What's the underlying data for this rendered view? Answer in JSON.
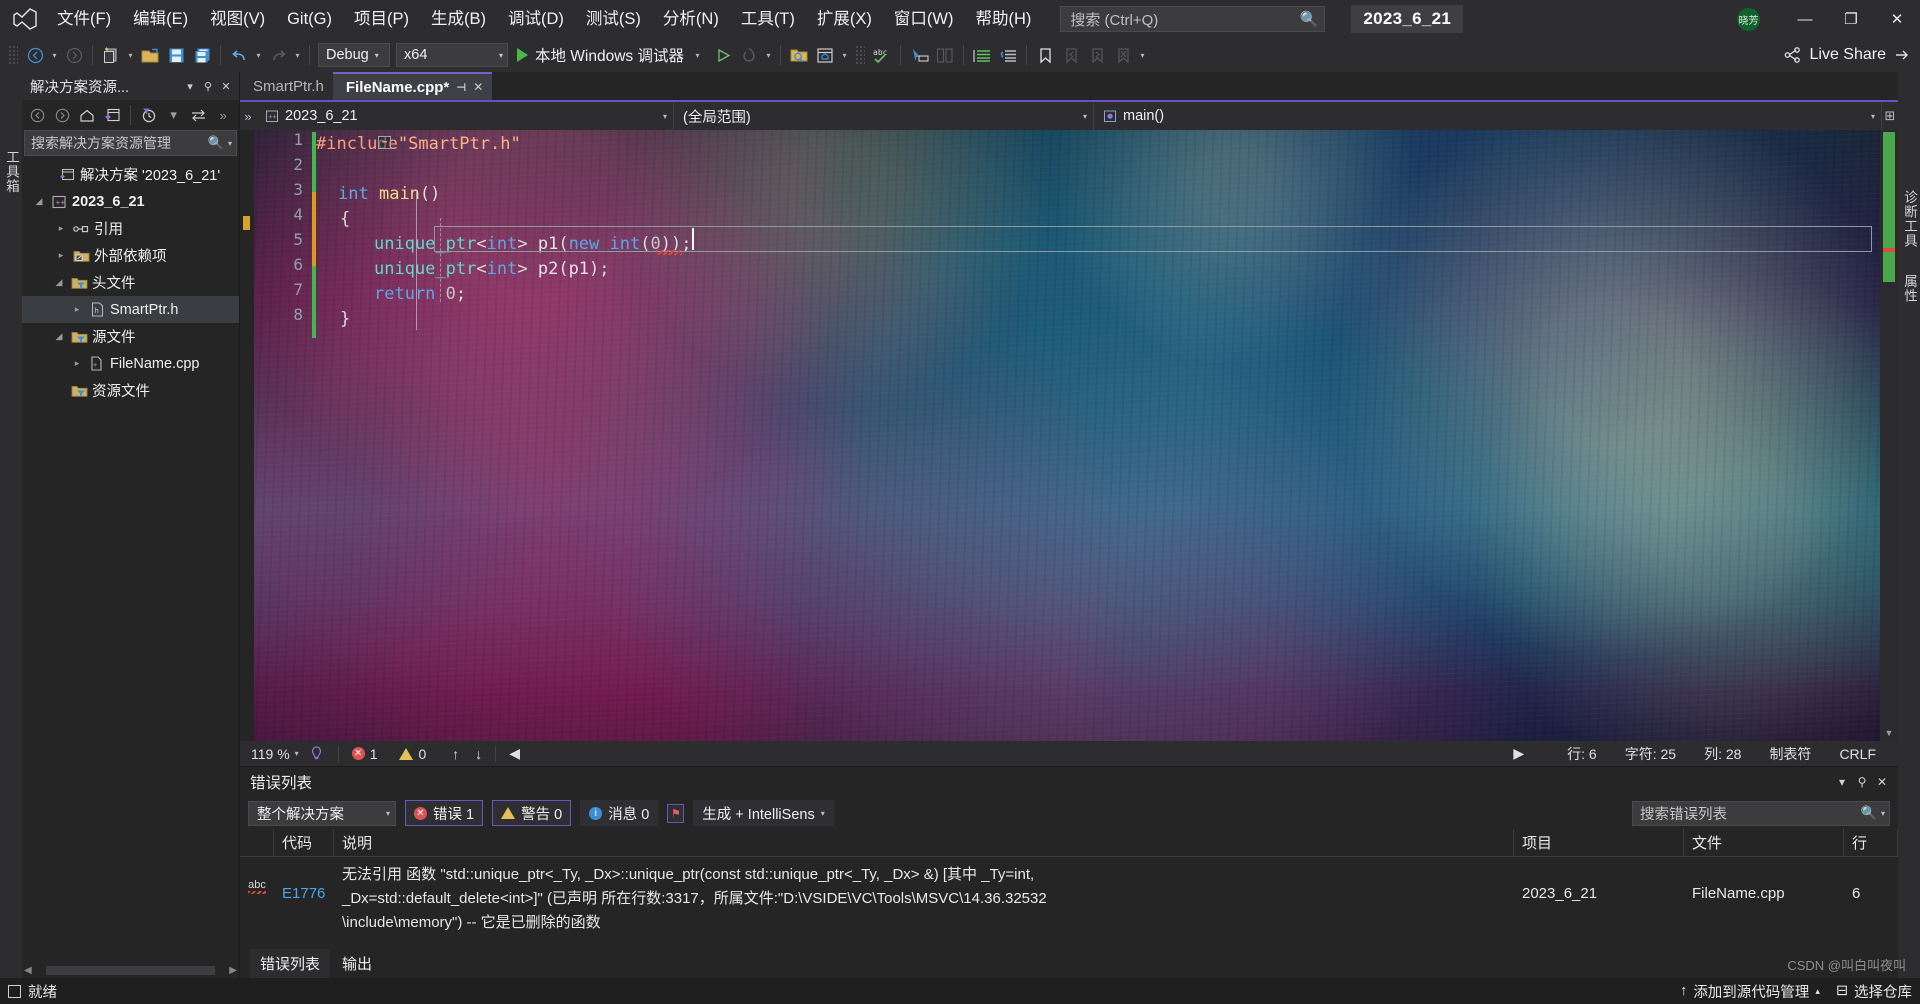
{
  "titlebar": {
    "logo_name": "visual-studio-logo",
    "menus": [
      "文件(F)",
      "编辑(E)",
      "视图(V)",
      "Git(G)",
      "项目(P)",
      "生成(B)",
      "调试(D)",
      "测试(S)",
      "分析(N)",
      "工具(T)",
      "扩展(X)",
      "窗口(W)",
      "帮助(H)"
    ],
    "search_placeholder": "搜索 (Ctrl+Q)",
    "window_title": "2023_6_21",
    "account_initials": "晓芳",
    "minimize": "—",
    "maximize": "❐",
    "close": "✕"
  },
  "toolbar": {
    "back": "←",
    "forward": "→",
    "new_item": "新建项",
    "open_file": "打开文件",
    "save": "保存",
    "save_all": "全部保存",
    "undo": "↶",
    "redo": "↷",
    "config_value": "Debug",
    "platform_value": "x64",
    "run_label": "本地 Windows 调试器",
    "live_share": "Live Share"
  },
  "rails": {
    "left_label": "工具箱",
    "right_top": "诊断工具",
    "right_bottom": "属性"
  },
  "solution_explorer": {
    "title": "解决方案资源...",
    "dropdown_icon": "chevron-down-icon",
    "pin_icon": "pin-icon",
    "close_icon": "close-icon",
    "search_placeholder": "搜索解决方案资源管理",
    "tree": [
      {
        "label": "解决方案 '2023_6_21'",
        "indent": 0,
        "twisty": "",
        "icon": "solution-icon",
        "bold": false,
        "selected": false
      },
      {
        "label": "2023_6_21",
        "indent": 1,
        "twisty": "▴",
        "icon": "project-icon",
        "bold": true,
        "selected": false
      },
      {
        "label": "引用",
        "indent": 2,
        "twisty": "▸",
        "icon": "references-icon",
        "bold": false,
        "selected": false
      },
      {
        "label": "外部依赖项",
        "indent": 2,
        "twisty": "▸",
        "icon": "folder-ext-icon",
        "bold": false,
        "selected": false
      },
      {
        "label": "头文件",
        "indent": 2,
        "twisty": "▴",
        "icon": "folder-filter-icon",
        "bold": false,
        "selected": false
      },
      {
        "label": "SmartPtr.h",
        "indent": 3,
        "twisty": "▸",
        "icon": "header-file-icon",
        "bold": false,
        "selected": true
      },
      {
        "label": "源文件",
        "indent": 2,
        "twisty": "▴",
        "icon": "folder-filter-icon",
        "bold": false,
        "selected": false
      },
      {
        "label": "FileName.cpp",
        "indent": 3,
        "twisty": "▸",
        "icon": "cpp-file-icon",
        "bold": false,
        "selected": false
      },
      {
        "label": "资源文件",
        "indent": 2,
        "twisty": "",
        "icon": "folder-filter-icon",
        "bold": false,
        "selected": false
      }
    ]
  },
  "editor": {
    "tabs": [
      {
        "label": "SmartPtr.h",
        "active": false,
        "modified": false
      },
      {
        "label": "FileName.cpp*",
        "active": true,
        "modified": true
      }
    ],
    "tab_pin_icon": "pin-icon",
    "tab_close_icon": "close-icon",
    "nav_project": "2023_6_21",
    "nav_scope": "(全局范围)",
    "nav_member": "main()",
    "lines": [
      {
        "n": "1",
        "text": "#include\"SmartPtr.h\""
      },
      {
        "n": "2",
        "text": ""
      },
      {
        "n": "3",
        "text": "int main()"
      },
      {
        "n": "4",
        "text": "{"
      },
      {
        "n": "5",
        "text": "    unique_ptr<int> p1(new int(0));"
      },
      {
        "n": "6",
        "text": "    unique_ptr<int> p2(p1);"
      },
      {
        "n": "7",
        "text": "    return 0;"
      },
      {
        "n": "8",
        "text": "}"
      }
    ],
    "status": {
      "zoom": "119 %",
      "error_count": "1",
      "warning_count": "0",
      "line_label": "行: 6",
      "char_label": "字符: 25",
      "col_label": "列: 28",
      "tab_label": "制表符",
      "eol_label": "CRLF"
    }
  },
  "error_list": {
    "title": "错误列表",
    "scope_value": "整个解决方案",
    "errors_label": "错误 1",
    "warnings_label": "警告 0",
    "messages_label": "消息 0",
    "filter_icon": "filter-icon",
    "build_filter": "生成 + IntelliSens",
    "search_placeholder": "搜索错误列表",
    "columns": [
      "",
      "代码",
      "说明",
      "项目",
      "文件",
      "行"
    ],
    "rows": [
      {
        "icon": "abc-squiggle-icon",
        "code": "E1776",
        "description_line1": "无法引用 函数 \"std::unique_ptr<_Ty, _Dx>::unique_ptr(const std::unique_ptr<_Ty, _Dx> &) [其中 _Ty=int,",
        "description_line2": "_Dx=std::default_delete<int>]\" (已声明 所在行数:3317，所属文件:\"D:\\VSIDE\\VC\\Tools\\MSVC\\14.36.32532",
        "description_line3": "\\include\\memory\") -- 它是已删除的函数",
        "project": "2023_6_21",
        "file": "FileName.cpp",
        "line": "6"
      }
    ],
    "footer_tabs": [
      {
        "label": "错误列表",
        "active": true
      },
      {
        "label": "输出",
        "active": false
      }
    ]
  },
  "statusbar": {
    "ready": "就绪",
    "source_control": "添加到源代码管理",
    "select_repo": "选择仓库"
  },
  "watermark": "CSDN @叫白叫夜叫",
  "colors": {
    "accent_purple": "#6c4fc4",
    "error_red": "#e05252",
    "warning_yellow": "#e4c05a",
    "info_blue": "#3a8fd6",
    "link_blue": "#4aa6e8",
    "run_green": "#49b849",
    "chrome_bg": "#2d2d30",
    "panel_bg": "#252526"
  }
}
